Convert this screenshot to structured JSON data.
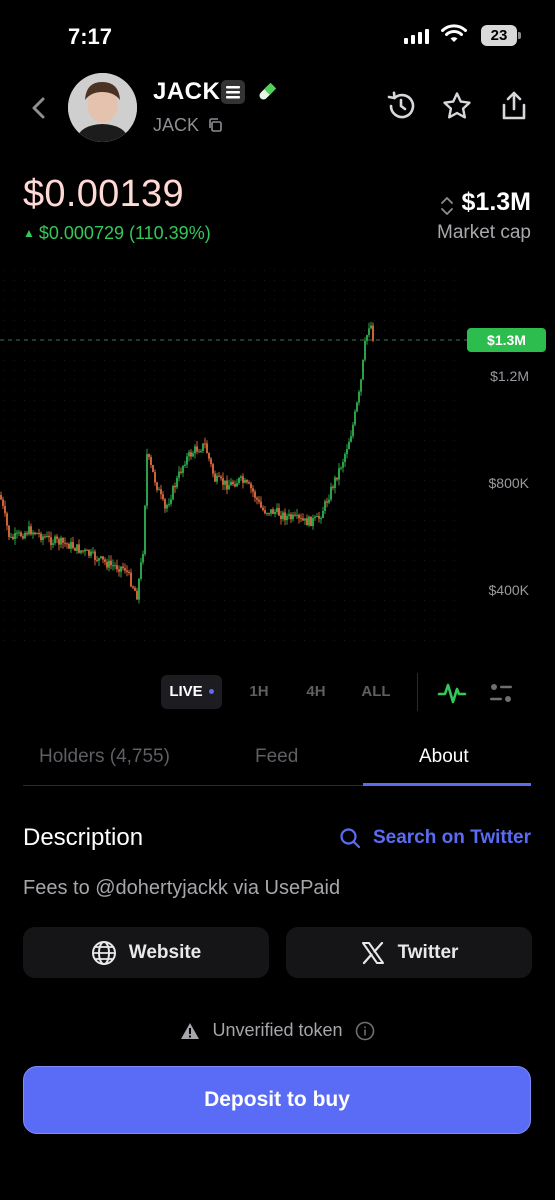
{
  "status_bar": {
    "time": "7:17",
    "battery": "23"
  },
  "token": {
    "name": "JACK",
    "ticker": "JACK"
  },
  "price": {
    "value": "$0.00139",
    "change": "$0.000729 (110.39%)",
    "market_cap": "$1.3M",
    "market_cap_label": "Market cap"
  },
  "chart": {
    "current_tag": "$1.3M",
    "ticks": [
      "$1.2M",
      "$800K",
      "$400K"
    ]
  },
  "timeframes": [
    "LIVE",
    "1H",
    "4H",
    "ALL"
  ],
  "tabs": [
    {
      "label": "Holders (4,755)",
      "active": false
    },
    {
      "label": "Feed",
      "active": false
    },
    {
      "label": "About",
      "active": true
    }
  ],
  "about": {
    "title": "Description",
    "search_label": "Search on Twitter",
    "description": "Fees to @dohertyjackk via UsePaid",
    "website_label": "Website",
    "twitter_label": "Twitter",
    "unverified_label": "Unverified token"
  },
  "deposit_label": "Deposit to buy",
  "colors": {
    "accent": "#5a6cf5",
    "up": "#34c759",
    "price": "#ffd9d3",
    "candle_up": "#34c759",
    "candle_down": "#ff7a45"
  }
}
